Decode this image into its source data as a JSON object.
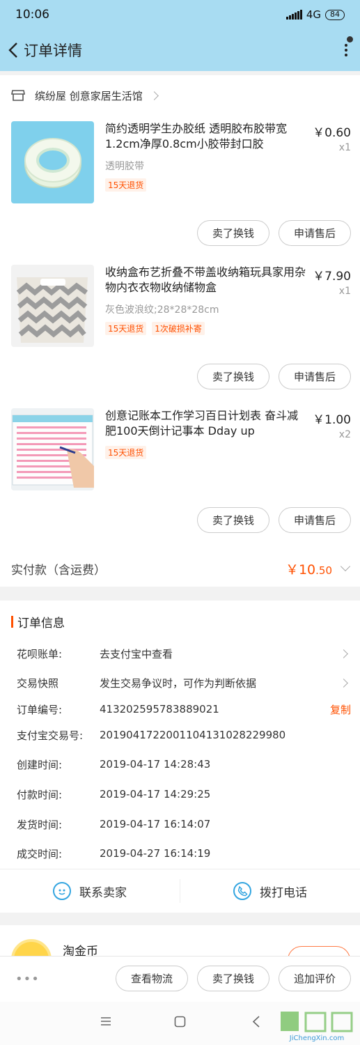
{
  "status_bar": {
    "time": "10:06",
    "network": "4G",
    "battery": "84"
  },
  "nav": {
    "title": "订单详情"
  },
  "shop": {
    "name": "缤纷屋 创意家居生活馆"
  },
  "items": [
    {
      "title": "简约透明学生办胶纸 透明胶布胶带宽1.2cm净厚0.8cm小胶带封口胶",
      "sku": "透明胶带",
      "price": "￥0.60",
      "qty": "x1",
      "tags": [
        "15天退货"
      ],
      "buttons": [
        "卖了换钱",
        "申请售后"
      ]
    },
    {
      "title": "收纳盒布艺折叠不带盖收纳箱玩具家用杂物内衣衣物收纳储物盒",
      "sku": "灰色波浪纹;28*28*28cm",
      "price": "￥7.90",
      "qty": "x1",
      "tags": [
        "15天退货",
        "1次破损补寄"
      ],
      "buttons": [
        "卖了换钱",
        "申请售后"
      ]
    },
    {
      "title": "创意记账本工作学习百日计划表 奋斗减肥100天倒计记事本 Dday up",
      "sku": "",
      "price": "￥1.00",
      "qty": "x2",
      "tags": [
        "15天退货"
      ],
      "buttons": [
        "卖了换钱",
        "申请售后"
      ]
    }
  ],
  "total": {
    "label": "实付款（含运费）",
    "currency": "￥",
    "integer": "10",
    "decimal": ".50"
  },
  "order_info": {
    "title": "订单信息",
    "rows": [
      {
        "key": "花呗账单:",
        "value": "去支付宝中查看"
      },
      {
        "key": "交易快照",
        "value": "发生交易争议时，可作为判断依据"
      },
      {
        "key": "订单编号:",
        "value": "413202595783889021",
        "action": "复制"
      },
      {
        "key": "支付宝交易号:",
        "value": "2019041722001104131028229980"
      },
      {
        "key": "创建时间:",
        "value": "2019-04-17 14:28:43"
      },
      {
        "key": "付款时间:",
        "value": "2019-04-17 14:29:25"
      },
      {
        "key": "发货时间:",
        "value": "2019-04-17 16:14:07"
      },
      {
        "key": "成交时间:",
        "value": "2019-04-27 16:14:19"
      }
    ]
  },
  "contact": {
    "seller": "联系卖家",
    "phone": "拨打电话"
  },
  "coin": {
    "label": "淘金币"
  },
  "bottom_bar": {
    "ellipsis": "•••",
    "buttons": [
      "查看物流",
      "卖了换钱",
      "追加评价"
    ]
  },
  "watermark": {
    "text": "JiChengXin.com"
  },
  "colors": {
    "accent": "#ff5000",
    "header": "#a8dcf2",
    "link_blue": "#33a5e0"
  }
}
